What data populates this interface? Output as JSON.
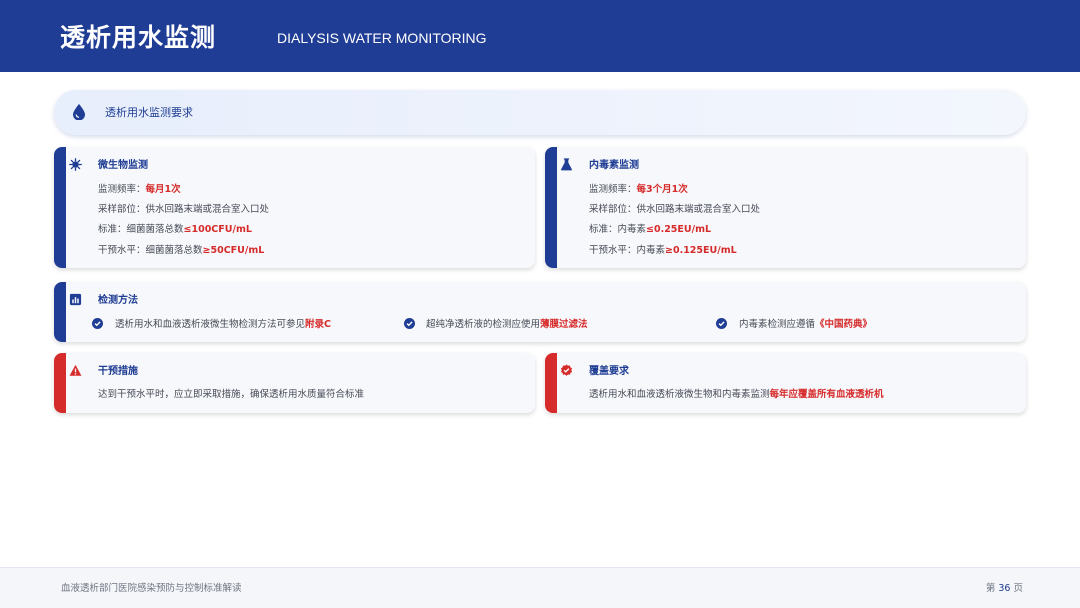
{
  "header": {
    "title": "透析用水监测",
    "subtitle": "DIALYSIS WATER MONITORING"
  },
  "banner": {
    "text": "透析用水监测要求",
    "icon": "water-drop-icon"
  },
  "microbe": {
    "title": "微生物监测",
    "icon": "microbe-icon",
    "freq_label": "监测频率：",
    "freq_value": "每月1次",
    "site": "采样部位：供水回路末端或混合室入口处",
    "std_label": "标准：细菌菌落总数",
    "std_value": "≤100CFU/mL",
    "act_label": "干预水平：细菌菌落总数",
    "act_value": "≥50CFU/mL"
  },
  "endotoxin": {
    "title": "内毒素监测",
    "icon": "flask-icon",
    "freq_label": "监测频率：",
    "freq_value": "每3个月1次",
    "site": "采样部位：供水回路末端或混合室入口处",
    "std_label": "标准：内毒素",
    "std_value": "≤0.25EU/mL",
    "act_label": "干预水平：内毒素",
    "act_value": "≥0.125EU/mL"
  },
  "methods": {
    "title": "检测方法",
    "icon": "chart-icon",
    "items": [
      {
        "text": "透析用水和血液透析液微生物检测方法可参见",
        "highlight": "附录C"
      },
      {
        "text": "超纯净透析液的检测应使用",
        "highlight": "薄膜过滤法"
      },
      {
        "text": "内毒素检测应遵循",
        "highlight": "《中国药典》"
      }
    ]
  },
  "intervention": {
    "title": "干预措施",
    "icon": "warning-icon",
    "text": "达到干预水平时，应立即采取措施，确保透析用水质量符合标准"
  },
  "coverage": {
    "title": "覆盖要求",
    "icon": "verified-badge-icon",
    "text": "透析用水和血液透析液微生物和内毒素监测",
    "highlight": "每年应覆盖所有血液透析机"
  },
  "footer": {
    "left": "血液透析部门医院感染预防与控制标准解读",
    "page_prefix": "第",
    "page_number": "36",
    "page_suffix": "页"
  },
  "colors": {
    "primary": "#1f3d94",
    "accent": "#d62b2b"
  }
}
